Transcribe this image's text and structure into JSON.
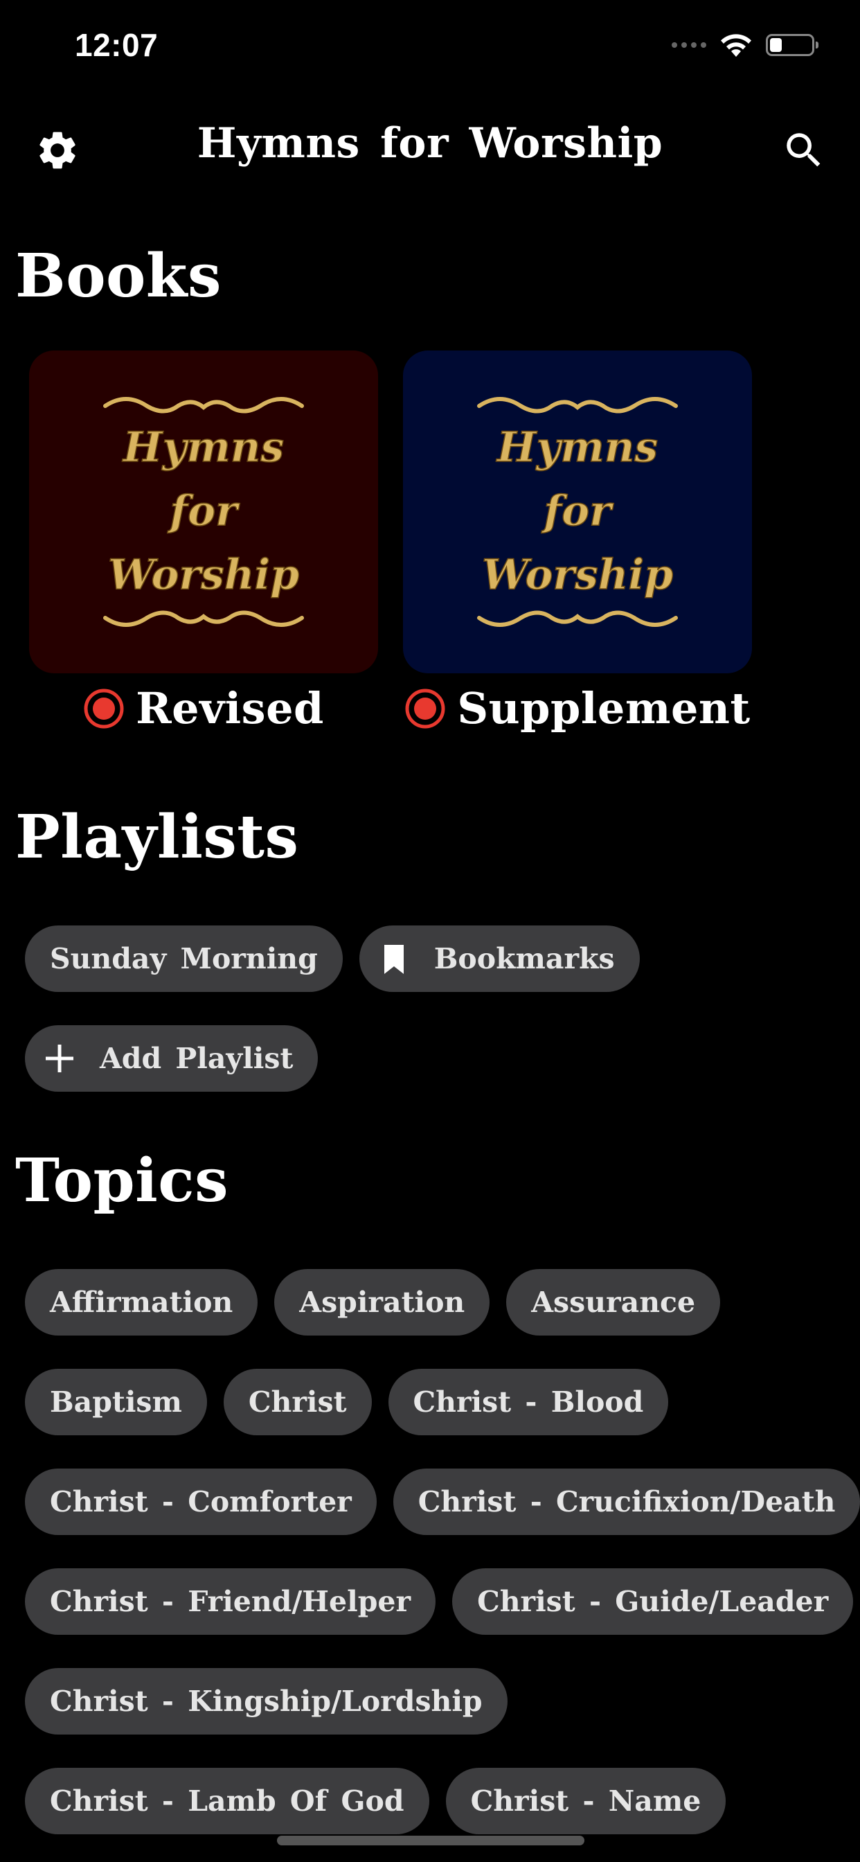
{
  "status_bar": {
    "time": "12:07",
    "battery_level": 0.3
  },
  "nav": {
    "title": "Hymns for Worship",
    "settings_icon": "gear-icon",
    "search_icon": "search-icon"
  },
  "books": {
    "heading": "Books",
    "items": [
      {
        "cover_lines": [
          "Hymns",
          "for",
          "Worship"
        ],
        "label": "Revised",
        "cover_color": "#260000",
        "selected": true
      },
      {
        "cover_lines": [
          "Hymns",
          "for",
          "Worship"
        ],
        "label": "Supplement",
        "cover_color": "#000a33",
        "selected": true
      }
    ]
  },
  "playlists": {
    "heading": "Playlists",
    "items": [
      {
        "label": "Sunday Morning",
        "icon": null
      },
      {
        "label": "Bookmarks",
        "icon": "bookmark-icon"
      },
      {
        "label": "Add Playlist",
        "icon": "plus-icon"
      }
    ]
  },
  "topics": {
    "heading": "Topics",
    "items": [
      "Affirmation",
      "Aspiration",
      "Assurance",
      "Baptism",
      "Christ",
      "Christ - Blood",
      "Christ - Comforter",
      "Christ - Crucifixion/Death",
      "Christ - Friend/Helper",
      "Christ - Guide/Leader",
      "Christ - Kingship/Lordship",
      "Christ - Lamb Of God",
      "Christ - Name"
    ]
  },
  "colors": {
    "background": "#000000",
    "chip": "#3d3d3f",
    "radio_accent": "#e8392f",
    "gold": "#d9b45f"
  }
}
